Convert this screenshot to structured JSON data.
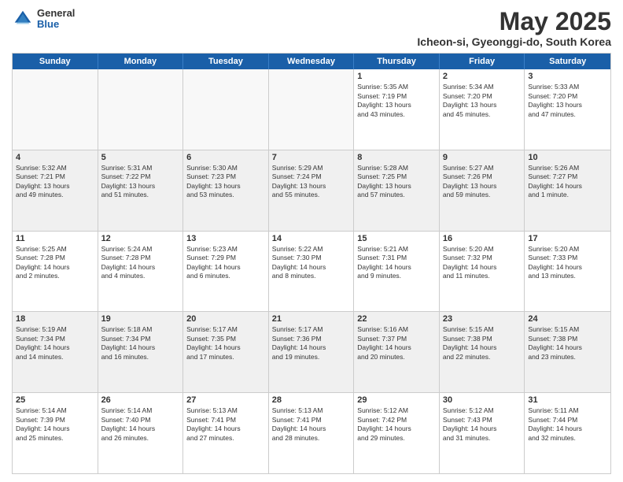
{
  "logo": {
    "general": "General",
    "blue": "Blue"
  },
  "title": {
    "month_year": "May 2025",
    "location": "Icheon-si, Gyeonggi-do, South Korea"
  },
  "weekdays": [
    "Sunday",
    "Monday",
    "Tuesday",
    "Wednesday",
    "Thursday",
    "Friday",
    "Saturday"
  ],
  "rows": [
    [
      {
        "day": "",
        "text": "",
        "empty": true
      },
      {
        "day": "",
        "text": "",
        "empty": true
      },
      {
        "day": "",
        "text": "",
        "empty": true
      },
      {
        "day": "",
        "text": "",
        "empty": true
      },
      {
        "day": "1",
        "text": "Sunrise: 5:35 AM\nSunset: 7:19 PM\nDaylight: 13 hours\nand 43 minutes."
      },
      {
        "day": "2",
        "text": "Sunrise: 5:34 AM\nSunset: 7:20 PM\nDaylight: 13 hours\nand 45 minutes."
      },
      {
        "day": "3",
        "text": "Sunrise: 5:33 AM\nSunset: 7:20 PM\nDaylight: 13 hours\nand 47 minutes."
      }
    ],
    [
      {
        "day": "4",
        "text": "Sunrise: 5:32 AM\nSunset: 7:21 PM\nDaylight: 13 hours\nand 49 minutes."
      },
      {
        "day": "5",
        "text": "Sunrise: 5:31 AM\nSunset: 7:22 PM\nDaylight: 13 hours\nand 51 minutes."
      },
      {
        "day": "6",
        "text": "Sunrise: 5:30 AM\nSunset: 7:23 PM\nDaylight: 13 hours\nand 53 minutes."
      },
      {
        "day": "7",
        "text": "Sunrise: 5:29 AM\nSunset: 7:24 PM\nDaylight: 13 hours\nand 55 minutes."
      },
      {
        "day": "8",
        "text": "Sunrise: 5:28 AM\nSunset: 7:25 PM\nDaylight: 13 hours\nand 57 minutes."
      },
      {
        "day": "9",
        "text": "Sunrise: 5:27 AM\nSunset: 7:26 PM\nDaylight: 13 hours\nand 59 minutes."
      },
      {
        "day": "10",
        "text": "Sunrise: 5:26 AM\nSunset: 7:27 PM\nDaylight: 14 hours\nand 1 minute."
      }
    ],
    [
      {
        "day": "11",
        "text": "Sunrise: 5:25 AM\nSunset: 7:28 PM\nDaylight: 14 hours\nand 2 minutes."
      },
      {
        "day": "12",
        "text": "Sunrise: 5:24 AM\nSunset: 7:28 PM\nDaylight: 14 hours\nand 4 minutes."
      },
      {
        "day": "13",
        "text": "Sunrise: 5:23 AM\nSunset: 7:29 PM\nDaylight: 14 hours\nand 6 minutes."
      },
      {
        "day": "14",
        "text": "Sunrise: 5:22 AM\nSunset: 7:30 PM\nDaylight: 14 hours\nand 8 minutes."
      },
      {
        "day": "15",
        "text": "Sunrise: 5:21 AM\nSunset: 7:31 PM\nDaylight: 14 hours\nand 9 minutes."
      },
      {
        "day": "16",
        "text": "Sunrise: 5:20 AM\nSunset: 7:32 PM\nDaylight: 14 hours\nand 11 minutes."
      },
      {
        "day": "17",
        "text": "Sunrise: 5:20 AM\nSunset: 7:33 PM\nDaylight: 14 hours\nand 13 minutes."
      }
    ],
    [
      {
        "day": "18",
        "text": "Sunrise: 5:19 AM\nSunset: 7:34 PM\nDaylight: 14 hours\nand 14 minutes."
      },
      {
        "day": "19",
        "text": "Sunrise: 5:18 AM\nSunset: 7:34 PM\nDaylight: 14 hours\nand 16 minutes."
      },
      {
        "day": "20",
        "text": "Sunrise: 5:17 AM\nSunset: 7:35 PM\nDaylight: 14 hours\nand 17 minutes."
      },
      {
        "day": "21",
        "text": "Sunrise: 5:17 AM\nSunset: 7:36 PM\nDaylight: 14 hours\nand 19 minutes."
      },
      {
        "day": "22",
        "text": "Sunrise: 5:16 AM\nSunset: 7:37 PM\nDaylight: 14 hours\nand 20 minutes."
      },
      {
        "day": "23",
        "text": "Sunrise: 5:15 AM\nSunset: 7:38 PM\nDaylight: 14 hours\nand 22 minutes."
      },
      {
        "day": "24",
        "text": "Sunrise: 5:15 AM\nSunset: 7:38 PM\nDaylight: 14 hours\nand 23 minutes."
      }
    ],
    [
      {
        "day": "25",
        "text": "Sunrise: 5:14 AM\nSunset: 7:39 PM\nDaylight: 14 hours\nand 25 minutes."
      },
      {
        "day": "26",
        "text": "Sunrise: 5:14 AM\nSunset: 7:40 PM\nDaylight: 14 hours\nand 26 minutes."
      },
      {
        "day": "27",
        "text": "Sunrise: 5:13 AM\nSunset: 7:41 PM\nDaylight: 14 hours\nand 27 minutes."
      },
      {
        "day": "28",
        "text": "Sunrise: 5:13 AM\nSunset: 7:41 PM\nDaylight: 14 hours\nand 28 minutes."
      },
      {
        "day": "29",
        "text": "Sunrise: 5:12 AM\nSunset: 7:42 PM\nDaylight: 14 hours\nand 29 minutes."
      },
      {
        "day": "30",
        "text": "Sunrise: 5:12 AM\nSunset: 7:43 PM\nDaylight: 14 hours\nand 31 minutes."
      },
      {
        "day": "31",
        "text": "Sunrise: 5:11 AM\nSunset: 7:44 PM\nDaylight: 14 hours\nand 32 minutes."
      }
    ]
  ]
}
